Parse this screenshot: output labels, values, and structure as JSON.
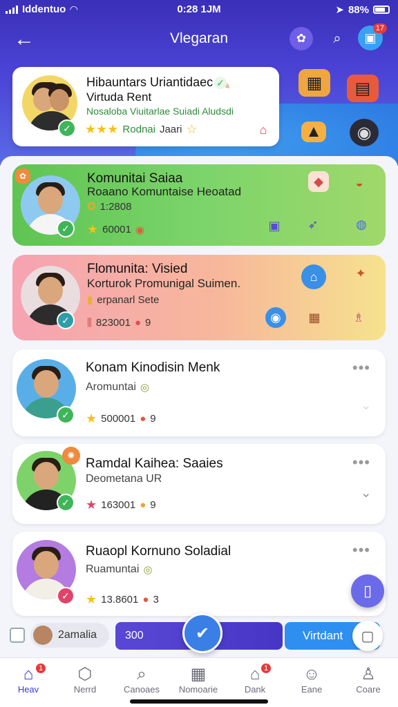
{
  "status_bar": {
    "carrier": "Iddentuo",
    "time": "0:28 1JM",
    "battery": "88%"
  },
  "nav": {
    "back_icon": "←",
    "title": "Vlegaran",
    "notif_badge": "17"
  },
  "featured": {
    "title": "Hibauntars Uriantidaec",
    "subtitle": "Virtuda Rent",
    "desc": "Nosaloba Viuitarlae Suiadi Aludsdi",
    "stars": "★★★",
    "meta_text": "Rodnai",
    "meta_text2": "Jaari"
  },
  "cards": [
    {
      "id": "c1",
      "name": "Komunitai Saiaa",
      "sub": "Roaano Komuntaise Heoatad",
      "line": "1:2808",
      "count": "60001",
      "theme": "green"
    },
    {
      "id": "c2",
      "name": "Flomunita: Visied",
      "sub": "Korturok Promunigal Suimen.",
      "line": "erpanarl Sete",
      "count": "823001",
      "count2": "9",
      "theme": "sunset"
    },
    {
      "id": "c3",
      "name": "Konam Kinodisin Menk",
      "sub": "Aromuntai",
      "count": "500001",
      "count2": "9",
      "theme": "white"
    },
    {
      "id": "c4",
      "name": "Ramdal Kaihea: Saaies",
      "sub": "Deometana UR",
      "count": "163001",
      "count2": "9",
      "theme": "white"
    },
    {
      "id": "c5",
      "name": "Ruaopl Kornuno Soladial",
      "sub": "Ruamuntai",
      "count": "13.8601",
      "count2": "3",
      "theme": "white"
    }
  ],
  "action_bar": {
    "chip_label": "2amalia",
    "progress_text": "300",
    "primary_button": "Virtdant"
  },
  "tabs": [
    {
      "label": "Heav",
      "icon": "home-icon",
      "glyph": "⌂",
      "badge": "1"
    },
    {
      "label": "Nerrd",
      "icon": "hexagon-icon",
      "glyph": "⬡"
    },
    {
      "label": "Canoaes",
      "icon": "search-icon",
      "glyph": "⌕"
    },
    {
      "label": "Nomoarie",
      "icon": "calendar-icon",
      "glyph": "▦"
    },
    {
      "label": "Dank",
      "icon": "house-icon",
      "glyph": "⌂",
      "badge": "1"
    },
    {
      "label": "Eane",
      "icon": "smile-icon",
      "glyph": "☺"
    },
    {
      "label": "Coare",
      "icon": "user-icon",
      "glyph": "♙"
    }
  ],
  "colors": {
    "accent": "#3a3ad4",
    "header": "#4b44d6",
    "verified": "#3fb55a"
  }
}
